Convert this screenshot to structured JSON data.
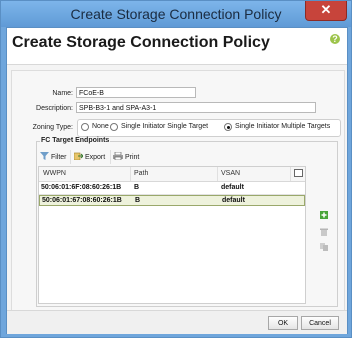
{
  "window": {
    "title": "Create Storage Connection Policy",
    "close_glyph": "✕"
  },
  "header": {
    "title": "Create Storage Connection Policy",
    "help_glyph": "?"
  },
  "form": {
    "name_label": "Name:",
    "name_value": "FCoE-B",
    "description_label": "Description:",
    "description_value": "SPB-B3-1 and SPA-A3-1",
    "zoning_label": "Zoning Type:",
    "zoning_options": [
      "None",
      "Single Initiator Single Target",
      "Single Initiator Multiple Targets"
    ],
    "zoning_selected": "Single Initiator Multiple Targets"
  },
  "targets": {
    "section_title": "FC Target Endpoints",
    "toolbar": {
      "filter_label": "Filter",
      "export_label": "Export",
      "print_label": "Print"
    },
    "columns": [
      "WWPN",
      "Path",
      "VSAN"
    ],
    "rows": [
      {
        "wwpn": "50:06:01:6F:08:60:26:1B",
        "path": "B",
        "vsan": "default"
      },
      {
        "wwpn": "50:06:01:67:08:60:26:1B",
        "path": "B",
        "vsan": "default"
      }
    ]
  },
  "footer": {
    "ok_label": "OK",
    "cancel_label": "Cancel"
  },
  "colors": {
    "accent": "#6fa6dc",
    "close": "#c7443b",
    "add": "#4aa53a",
    "selected_row": "#eef2dc"
  },
  "icons": [
    "close-icon",
    "help-icon",
    "filter-icon",
    "export-icon",
    "print-icon",
    "column-chooser-icon",
    "add-icon",
    "delete-icon",
    "properties-icon"
  ]
}
